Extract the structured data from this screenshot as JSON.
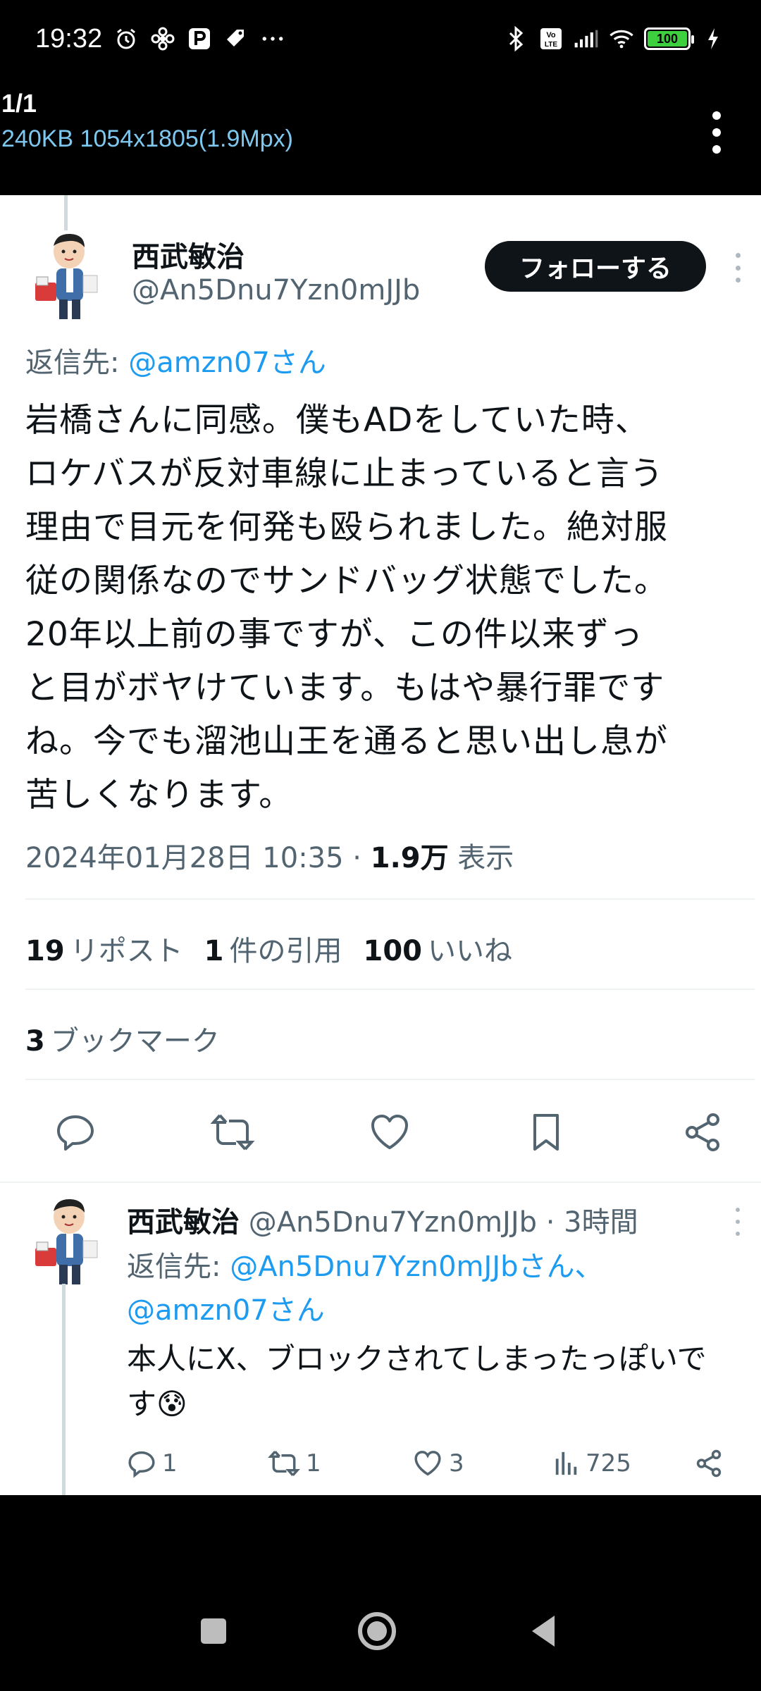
{
  "status_bar": {
    "time": "19:32",
    "battery": "100",
    "icons": [
      "alarm-icon",
      "pinwheel-icon",
      "parking-icon",
      "tag-icon",
      "more-dots-icon",
      "bluetooth-icon",
      "volte-icon",
      "signal-icon",
      "wifi-icon",
      "battery-icon",
      "charging-icon"
    ]
  },
  "viewer": {
    "count": "1/1",
    "meta": "240KB 1054x1805(1.9Mpx)"
  },
  "tweet": {
    "author_name": "西武敏治",
    "author_handle": "@An5Dnu7Yzn0mJJb",
    "follow_label": "フォローする",
    "reply_prefix": "返信先: ",
    "reply_mention": "@amzn07さん",
    "body_lines": [
      "岩橋さんに同感。僕もADをしていた時、",
      "ロケバスが反対車線に止まっていると言う",
      "理由で目元を何発も殴られました。絶対服",
      "従の関係なのでサンドバッグ状態でした。",
      "20年以上前の事ですが、この件以来ずっ",
      "と目がボヤけています。もはや暴行罪です",
      "ね。今でも溜池山王を通ると思い出し息が",
      "苦しくなります。"
    ],
    "timestamp": "2024年01月28日 10:35 · ",
    "views_count": "1.9万",
    "views_label": " 表示",
    "reposts_count": "19",
    "reposts_label": "リポスト",
    "quotes_count": "1",
    "quotes_label": "件の引用",
    "likes_count": "100",
    "likes_label": "いいね",
    "bookmarks_count": "3",
    "bookmarks_label": "ブックマーク"
  },
  "reply": {
    "author_name": "西武敏治",
    "author_handle": "@An5Dnu7Yzn0mJJb",
    "time_ago": " · 3時間",
    "reply_prefix": "返信先: ",
    "reply_mention_1": "@An5Dnu7Yzn0mJJbさん、",
    "reply_mention_2": "@amzn07さん",
    "body_line_1": "本人にX、ブロックされてしまったっぽいで",
    "body_line_2": "す",
    "emoji": "😰",
    "replies": "1",
    "reposts": "1",
    "likes": "3",
    "views": "725"
  },
  "colors": {
    "accent": "#1d9bf0",
    "text_primary": "#0f1419",
    "text_secondary": "#536471",
    "battery_green": "#3ecf3e",
    "viewer_meta": "#7ec8f0"
  }
}
